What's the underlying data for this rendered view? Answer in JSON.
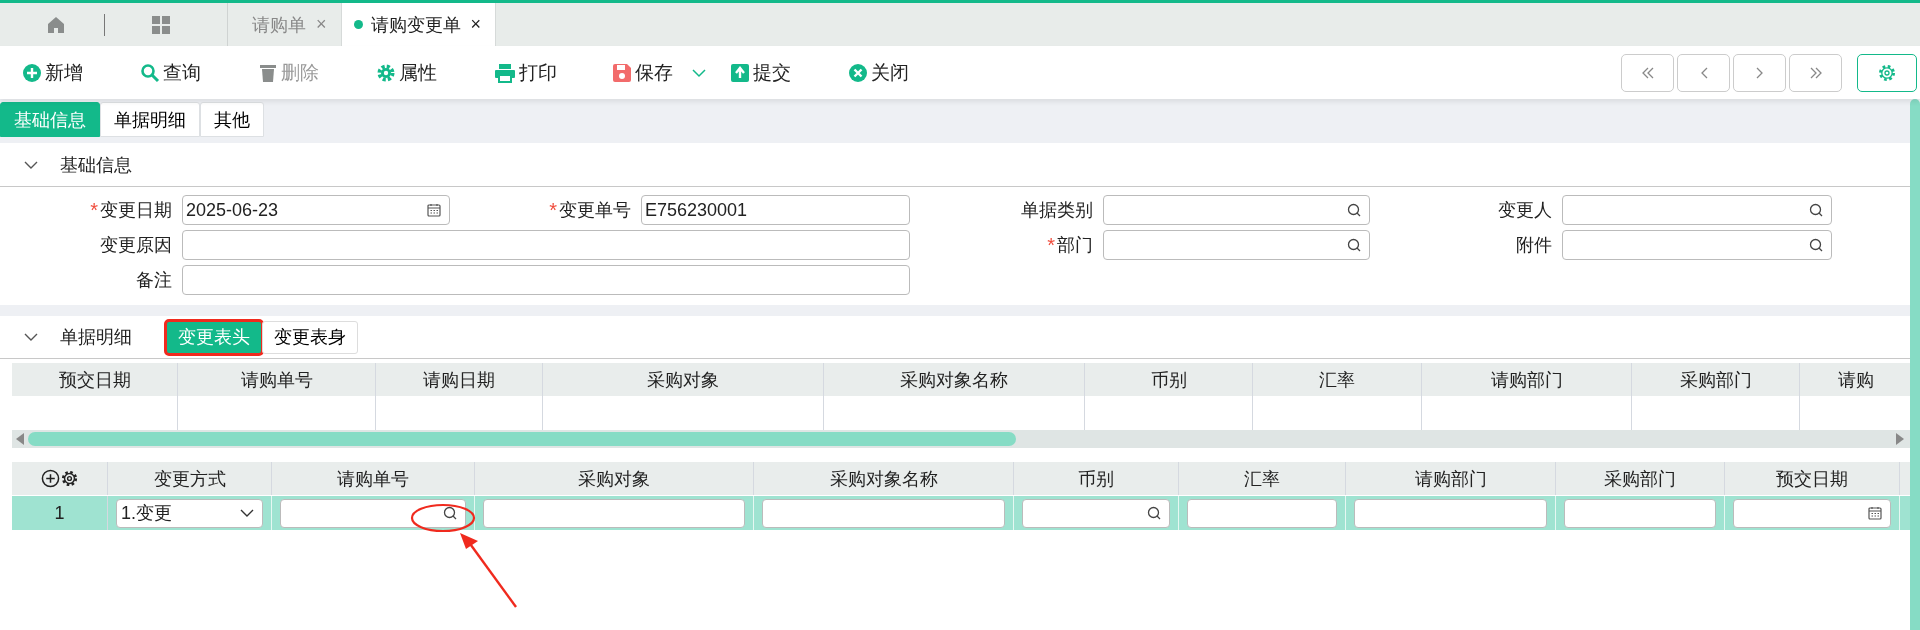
{
  "doc_tabs": [
    {
      "label": "请购单",
      "selected": false,
      "close": "×"
    },
    {
      "label": "请购变更单",
      "selected": true,
      "close": "×"
    }
  ],
  "toolbar": [
    {
      "label": "新增",
      "kind": "plus",
      "disabled": false,
      "dropdown": false
    },
    {
      "label": "查询",
      "kind": "search",
      "disabled": false,
      "dropdown": false
    },
    {
      "label": "删除",
      "kind": "trash",
      "disabled": true,
      "dropdown": false
    },
    {
      "label": "属性",
      "kind": "gear",
      "disabled": false,
      "dropdown": false
    },
    {
      "label": "打印",
      "kind": "printer",
      "disabled": false,
      "dropdown": false
    },
    {
      "label": "保存",
      "kind": "save",
      "disabled": false,
      "dropdown": true
    },
    {
      "label": "提交",
      "kind": "submit",
      "disabled": false,
      "dropdown": false
    },
    {
      "label": "关闭",
      "kind": "close",
      "disabled": false,
      "dropdown": false
    }
  ],
  "page_tabs": [
    {
      "label": "基础信息",
      "selected": true
    },
    {
      "label": "单据明细",
      "selected": false
    },
    {
      "label": "其他",
      "selected": false
    }
  ],
  "basic_section": {
    "title": "基础信息",
    "expanded": true,
    "fields": [
      {
        "label": "变更日期",
        "required_mark": "*",
        "kind": "date",
        "value": "2025-06-23",
        "wide": false
      },
      {
        "label": "变更单号",
        "required_mark": "*",
        "kind": "text",
        "value": "E756230001",
        "wide": false
      },
      {
        "label": "单据类别",
        "kind": "lookup",
        "wide": false
      },
      {
        "label": "变更人",
        "kind": "lookup",
        "wide": false
      },
      {
        "label": "变更原因",
        "kind": "text",
        "wide": true
      },
      {
        "label": "部门",
        "required_mark": "*",
        "kind": "lookup",
        "wide": false
      },
      {
        "label": "附件",
        "kind": "lookup",
        "wide": false
      },
      {
        "label": "备注",
        "kind": "text",
        "wide": true
      }
    ]
  },
  "detail_section": {
    "title": "单据明细",
    "expanded": true,
    "buttons": [
      {
        "label": "变更表头",
        "selected": true,
        "highlighted": true
      },
      {
        "label": "变更表身",
        "selected": false,
        "highlighted": false
      }
    ]
  },
  "header_grid": {
    "columns": [
      "预交日期",
      "请购单号",
      "请购日期",
      "采购对象",
      "采购对象名称",
      "币别",
      "汇率",
      "请购部门",
      "采购部门",
      "请购"
    ]
  },
  "body_grid": {
    "columns": [
      {
        "label": "变更方式",
        "kind": "select"
      },
      {
        "label": "请购单号",
        "kind": "lookup"
      },
      {
        "label": "采购对象",
        "kind": "text"
      },
      {
        "label": "采购对象名称",
        "kind": "text"
      },
      {
        "label": "币别",
        "kind": "lookup"
      },
      {
        "label": "汇率",
        "kind": "text"
      },
      {
        "label": "请购部门",
        "kind": "text"
      },
      {
        "label": "采购部门",
        "kind": "text"
      },
      {
        "label": "预交日期",
        "kind": "date"
      }
    ],
    "rows": [
      {
        "index": "1",
        "selected": true,
        "change_mode": "1.变更"
      }
    ]
  }
}
